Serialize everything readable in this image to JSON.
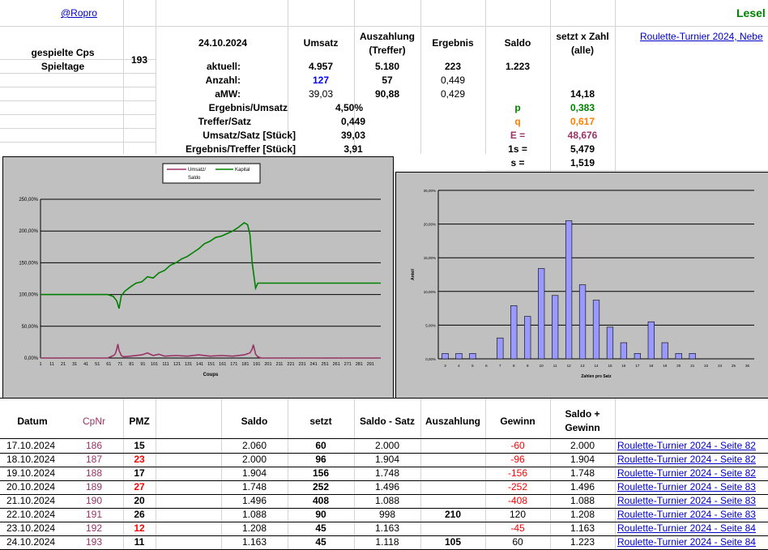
{
  "header": {
    "handle": "@Ropro",
    "lesel": "Lesel",
    "top_link": "Roulette-Turnier 2024, Nebe",
    "played_label_1": "gespielte Cps",
    "played_label_2": "Spieltage",
    "played_value": "193",
    "date": "24.10.2024",
    "col_umsatz": "Umsatz",
    "col_auszahlung_1": "Auszahlung",
    "col_auszahlung_2": "(Treffer)",
    "col_ergebnis": "Ergebnis",
    "col_saldo": "Saldo",
    "col_setzt_1": "setzt x Zahl",
    "col_setzt_2": "(alle)"
  },
  "stats": {
    "aktuell_label": "aktuell:",
    "aktuell_umsatz": "4.957",
    "aktuell_auszahlung": "5.180",
    "aktuell_ergebnis": "223",
    "aktuell_saldo": "1.223",
    "anzahl_label": "Anzahl:",
    "anzahl_umsatz": "127",
    "anzahl_auszahlung": "57",
    "anzahl_ergebnis": "0,449",
    "amw_label": "aMW:",
    "amw_umsatz": "39,03",
    "amw_auszahlung": "90,88",
    "amw_ergebnis": "0,429",
    "amw_setzt": "14,18",
    "ergebnis_umsatz_label": "Ergebnis/Umsatz",
    "ergebnis_umsatz_value": "4,50%",
    "treffer_satz_label": "Treffer/Satz",
    "treffer_satz_value": "0,449",
    "umsatz_satz_label": "Umsatz/Satz [Stück]",
    "umsatz_satz_value": "39,03",
    "ergebnis_treffer_label": "Ergebnis/Treffer [Stück]",
    "ergebnis_treffer_value": "3,91",
    "p_label": "p",
    "p_value": "0,383",
    "q_label": "q",
    "q_value": "0,617",
    "e_label": "E =",
    "e_value": "48,676",
    "s1_label": "1s =",
    "s1_value": "5,479",
    "s_label": "s =",
    "s_value": "1,519"
  },
  "colors": {
    "green": "#008000",
    "orange": "#ff8000",
    "purple": "#993366",
    "bar": "#9999ff",
    "kapital": "#008000",
    "umsatz": "#993366"
  },
  "chart_data": [
    {
      "type": "line",
      "legend": [
        "Umsatz/ Saldo",
        "Kapital"
      ],
      "xlabel": "Coups",
      "ylim": [
        0,
        250
      ],
      "yticks": [
        "0,00%",
        "50,00%",
        "100,00%",
        "150,00%",
        "200,00%",
        "250,00%"
      ],
      "xticks": [
        "1",
        "11",
        "21",
        "31",
        "41",
        "51",
        "61",
        "71",
        "81",
        "91",
        "101",
        "111",
        "121",
        "131",
        "141",
        "151",
        "161",
        "171",
        "181",
        "191",
        "201",
        "211",
        "221",
        "231",
        "241",
        "251",
        "261",
        "271",
        "281",
        "291"
      ],
      "series": [
        {
          "name": "Kapital",
          "x": [
            1,
            60,
            65,
            68,
            70,
            72,
            75,
            80,
            85,
            90,
            95,
            100,
            105,
            110,
            115,
            120,
            125,
            130,
            135,
            140,
            145,
            150,
            155,
            160,
            165,
            170,
            175,
            180,
            183,
            185,
            187,
            190,
            192,
            195,
            200,
            250,
            300
          ],
          "y": [
            100,
            100,
            97,
            90,
            78,
            98,
            105,
            112,
            118,
            120,
            128,
            126,
            134,
            138,
            146,
            150,
            156,
            160,
            166,
            172,
            180,
            184,
            190,
            192,
            196,
            200,
            206,
            213,
            210,
            195,
            150,
            110,
            118,
            118,
            118,
            118,
            118
          ]
        },
        {
          "name": "Umsatz/ Saldo",
          "x": [
            1,
            60,
            64,
            66,
            67,
            68,
            69,
            70,
            72,
            74,
            80,
            90,
            95,
            100,
            105,
            110,
            120,
            130,
            140,
            150,
            160,
            170,
            180,
            185,
            187,
            188,
            189,
            190,
            192,
            195,
            300
          ],
          "y": [
            0,
            0,
            3,
            5,
            8,
            14,
            22,
            12,
            4,
            2,
            3,
            5,
            8,
            4,
            6,
            3,
            4,
            3,
            5,
            3,
            4,
            3,
            5,
            8,
            14,
            21,
            14,
            6,
            2,
            0,
            0
          ]
        }
      ]
    },
    {
      "type": "bar",
      "xlabel": "Zahlen pro Satz",
      "ylabel": "Anteil",
      "ylim": [
        0,
        25
      ],
      "yticks": [
        "0,00%",
        "5,00%",
        "10,00%",
        "15,00%",
        "20,00%",
        "25,00%"
      ],
      "categories": [
        "3",
        "4",
        "5",
        "6",
        "7",
        "8",
        "9",
        "10",
        "11",
        "12",
        "13",
        "14",
        "15",
        "16",
        "17",
        "18",
        "19",
        "20",
        "21",
        "22",
        "24",
        "25",
        "36"
      ],
      "values": [
        0.8,
        0.8,
        0.8,
        3.1,
        7.9,
        6.3,
        13.4,
        9.4,
        20.5,
        11.0,
        8.7,
        4.7,
        2.4,
        0.8,
        5.5,
        2.4,
        0.8,
        0.8
      ],
      "bar_categories": [
        "3",
        "4",
        "5",
        "7",
        "8",
        "9",
        "10",
        "11",
        "12",
        "13",
        "14",
        "15",
        "16",
        "17",
        "18",
        "19",
        "20",
        "21"
      ]
    }
  ],
  "table": {
    "headers": {
      "datum": "Datum",
      "cpnr": "CpNr",
      "pmz": "PMZ",
      "saldo": "Saldo",
      "setzt": "setzt",
      "saldo_satz": "Saldo - Satz",
      "auszahlung": "Auszahlung",
      "gewinn": "Gewinn",
      "saldo_gewinn_1": "Saldo +",
      "saldo_gewinn_2": "Gewinn"
    },
    "rows": [
      {
        "datum": "17.10.2024",
        "cpnr": "186",
        "pmz": "15",
        "pmz_red": false,
        "saldo": "2.060",
        "setzt": "60",
        "saldo_satz": "2.000",
        "auszahlung": "",
        "gewinn": "-60",
        "gewinn_red": true,
        "saldo_gewinn": "2.000",
        "link": "Roulette-Turnier 2024 - Seite 82"
      },
      {
        "datum": "18.10.2024",
        "cpnr": "187",
        "pmz": "23",
        "pmz_red": true,
        "saldo": "2.000",
        "setzt": "96",
        "saldo_satz": "1.904",
        "auszahlung": "",
        "gewinn": "-96",
        "gewinn_red": true,
        "saldo_gewinn": "1.904",
        "link": "Roulette-Turnier 2024 - Seite 82"
      },
      {
        "datum": "19.10.2024",
        "cpnr": "188",
        "pmz": "17",
        "pmz_red": false,
        "saldo": "1.904",
        "setzt": "156",
        "saldo_satz": "1.748",
        "auszahlung": "",
        "gewinn": "-156",
        "gewinn_red": true,
        "saldo_gewinn": "1.748",
        "link": "Roulette-Turnier 2024 - Seite 82"
      },
      {
        "datum": "20.10.2024",
        "cpnr": "189",
        "pmz": "27",
        "pmz_red": true,
        "saldo": "1.748",
        "setzt": "252",
        "saldo_satz": "1.496",
        "auszahlung": "",
        "gewinn": "-252",
        "gewinn_red": true,
        "saldo_gewinn": "1.496",
        "link": "Roulette-Turnier 2024 - Seite 83"
      },
      {
        "datum": "21.10.2024",
        "cpnr": "190",
        "pmz": "20",
        "pmz_red": false,
        "saldo": "1.496",
        "setzt": "408",
        "saldo_satz": "1.088",
        "auszahlung": "",
        "gewinn": "-408",
        "gewinn_red": true,
        "saldo_gewinn": "1.088",
        "link": "Roulette-Turnier 2024 - Seite 83"
      },
      {
        "datum": "22.10.2024",
        "cpnr": "191",
        "pmz": "26",
        "pmz_red": false,
        "saldo": "1.088",
        "setzt": "90",
        "saldo_satz": "998",
        "auszahlung": "210",
        "gewinn": "120",
        "gewinn_red": false,
        "saldo_gewinn": "1.208",
        "link": "Roulette-Turnier 2024 - Seite 83"
      },
      {
        "datum": "23.10.2024",
        "cpnr": "192",
        "pmz": "12",
        "pmz_red": true,
        "saldo": "1.208",
        "setzt": "45",
        "saldo_satz": "1.163",
        "auszahlung": "",
        "gewinn": "-45",
        "gewinn_red": true,
        "saldo_gewinn": "1.163",
        "link": "Roulette-Turnier 2024 - Seite 84"
      },
      {
        "datum": "24.10.2024",
        "cpnr": "193",
        "pmz": "11",
        "pmz_red": false,
        "saldo": "1.163",
        "setzt": "45",
        "saldo_satz": "1.118",
        "auszahlung": "105",
        "gewinn": "60",
        "gewinn_red": false,
        "saldo_gewinn": "1.223",
        "link": "Roulette-Turnier 2024 - Seite 84"
      }
    ]
  }
}
